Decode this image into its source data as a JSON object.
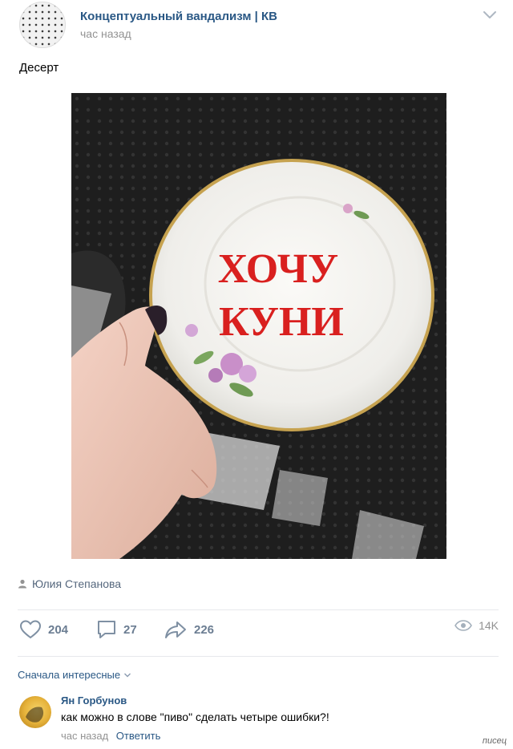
{
  "post": {
    "group_name": "Концептуальный вандализм | КВ",
    "time": "час назад",
    "text": "Десерт",
    "plate_text_line1": "ХОЧУ",
    "plate_text_line2": "КУНИ",
    "author": "Юлия Степанова"
  },
  "actions": {
    "likes": "204",
    "comments": "27",
    "shares": "226",
    "views": "14K"
  },
  "comments_section": {
    "sort_label": "Сначала интересные",
    "items": [
      {
        "author": "Ян Горбунов",
        "text": "как можно в слове \"пиво\" сделать четыре ошибки?!",
        "time": "час назад",
        "reply_label": "Ответить"
      }
    ]
  },
  "watermark": "писец",
  "colors": {
    "link": "#2a5885",
    "muted": "#939393",
    "action": "#6b7d92",
    "plate_text": "#d9201f"
  }
}
